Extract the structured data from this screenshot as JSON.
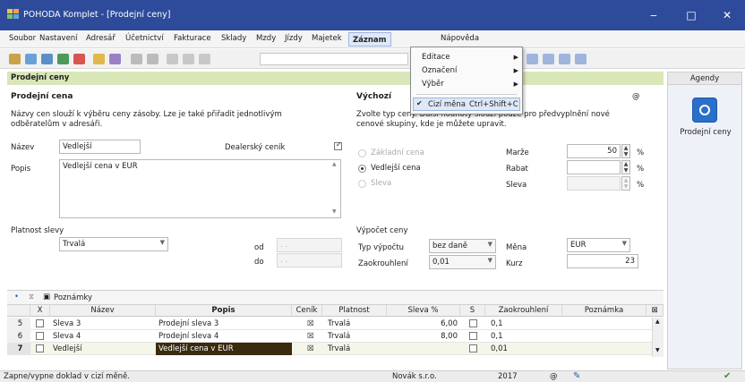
{
  "window": {
    "title": "POHODA Komplet - [Prodejní ceny]",
    "minimize": "‒",
    "maximize": "□",
    "close": "✕"
  },
  "menu": [
    "Soubor",
    "Nastavení",
    "Adresář",
    "Účetnictví",
    "Fakturace",
    "Sklady",
    "Mzdy",
    "Jízdy",
    "Majetek",
    "Záznam",
    "Nápověda"
  ],
  "active_menu": "Záznam",
  "popup": {
    "items": [
      "Editace",
      "Označení",
      "Výběr"
    ],
    "checked_item": "Cizí měna",
    "checked_shortcut": "Ctrl+Shift+C"
  },
  "panel": {
    "title": "Prodejní ceny"
  },
  "form": {
    "section_title": "Prodejní cena",
    "description": "Názvy cen slouží k výběru ceny zásoby. Lze je také přiřadit jednotlivým odběratelům v adresáři.",
    "name_label": "Název",
    "name_value": "Vedlejší",
    "dealer_label": "Dealerský ceník",
    "desc_label": "Popis",
    "desc_value": "Vedlejší cena v EUR",
    "validity_title": "Platnost slevy",
    "validity_value": "Trvalá",
    "from_label": "od",
    "to_label": "do",
    "from_value": ". .",
    "to_value": ". .",
    "right_title": "Výchozí",
    "right_at": "@",
    "right_desc": "Zvolte typ ceny. Další hodnoty slouží pouze pro předvyplnění nové cenové skupiny, kde je můžete upravit.",
    "radio_base": "Základní cena",
    "radio_side": "Vedlejší cena",
    "radio_discount": "Sleva",
    "margin_label": "Marže",
    "margin_value": "50",
    "rabat_label": "Rabat",
    "sleva_label": "Sleva",
    "percent": "%",
    "calc_title": "Výpočet ceny",
    "calc_type_label": "Typ výpočtu",
    "calc_type_value": "bez daně",
    "currency_label": "Měna",
    "currency_value": "EUR",
    "round_label": "Zaokrouhlení",
    "round_value": "0,01",
    "rate_label": "Kurz",
    "rate_value": "23"
  },
  "agenda": {
    "header": "Agendy",
    "item": "Prodejní ceny",
    "icon": "pohoda-logo-icon",
    "accent": "#2a6fc9"
  },
  "grid": {
    "tab_label": "Poznámky",
    "headers": [
      "X",
      "Název",
      "Popis",
      "Ceník",
      "Platnost",
      "Sleva %",
      "S",
      "Zaokrouhlení",
      "Poznámka"
    ],
    "rows": [
      {
        "n": "5",
        "name": "Sleva 3",
        "desc": "Prodejní sleva 3",
        "validity": "Trvalá",
        "discount": "6,00",
        "round": "0,1"
      },
      {
        "n": "6",
        "name": "Sleva 4",
        "desc": "Prodejní sleva 4",
        "validity": "Trvalá",
        "discount": "8,00",
        "round": "0,1"
      },
      {
        "n": "7",
        "name": "Vedlejší",
        "desc": "Vedlejší cena v EUR",
        "validity": "Trvalá",
        "discount": "",
        "round": "0,01"
      }
    ]
  },
  "status": {
    "hint": "Zapne/vypne doklad v cizí měně.",
    "company": "Novák s.r.o.",
    "year": "2017",
    "at": "@"
  }
}
